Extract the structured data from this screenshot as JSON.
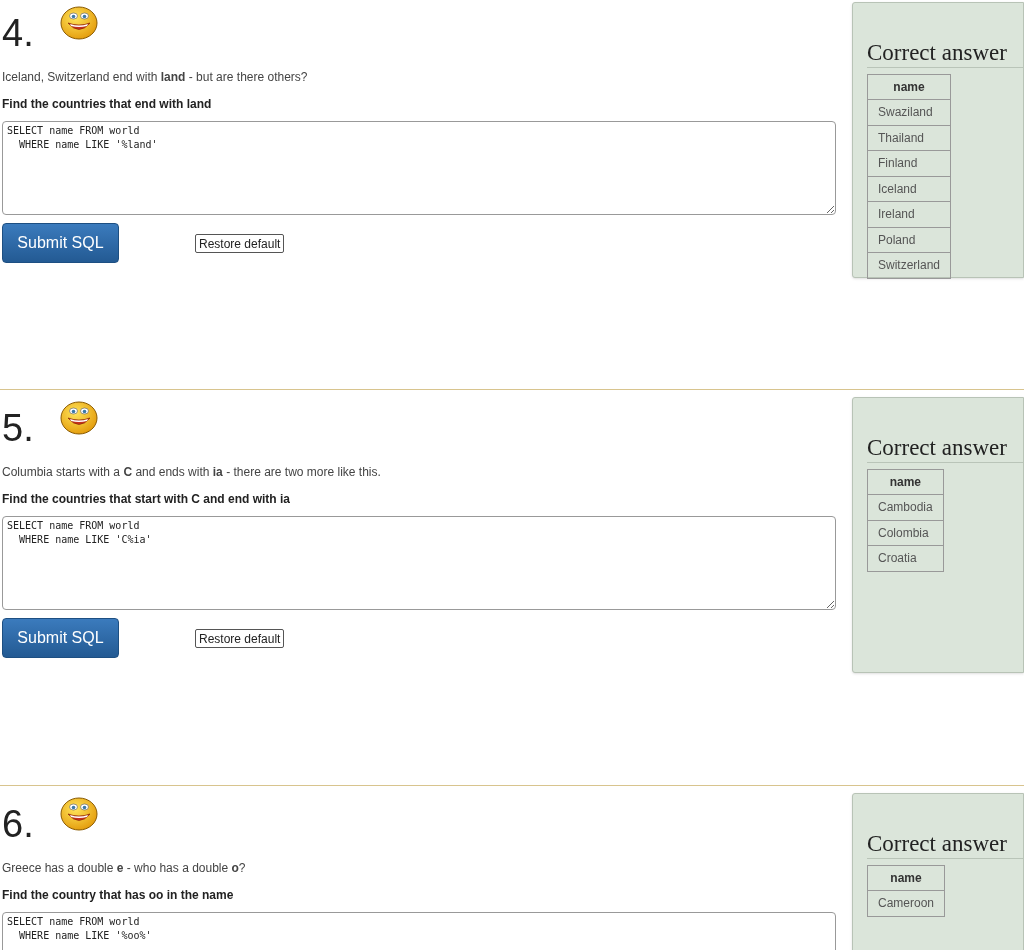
{
  "questions": [
    {
      "number": "4.",
      "intro": "Iceland, Switzerland end with **land** - but are there others?",
      "task": "Find the countries that end with land",
      "sql": "SELECT name FROM world\n  WHERE name LIKE '%land'",
      "buttons": {
        "submit": "Submit SQL",
        "restore": "Restore default"
      },
      "answer": {
        "title": "Correct answer",
        "column": "name",
        "rows": [
          "Swaziland",
          "Thailand",
          "Finland",
          "Iceland",
          "Ireland",
          "Poland",
          "Switzerland"
        ]
      }
    },
    {
      "number": "5.",
      "intro": "Columbia starts with a **C** and ends with **ia** - there are two more like this.",
      "task": "Find the countries that start with C and end with ia",
      "sql": "SELECT name FROM world\n  WHERE name LIKE 'C%ia'",
      "buttons": {
        "submit": "Submit SQL",
        "restore": "Restore default"
      },
      "answer": {
        "title": "Correct answer",
        "column": "name",
        "rows": [
          "Cambodia",
          "Colombia",
          "Croatia"
        ]
      }
    },
    {
      "number": "6.",
      "intro": "Greece has a double **e** - who has a double **o**?",
      "task": "Find the country that has oo in the name",
      "sql": "SELECT name FROM world\n  WHERE name LIKE '%oo%'",
      "answer": {
        "title": "Correct answer",
        "column": "name",
        "rows": [
          "Cameroon"
        ]
      }
    }
  ]
}
